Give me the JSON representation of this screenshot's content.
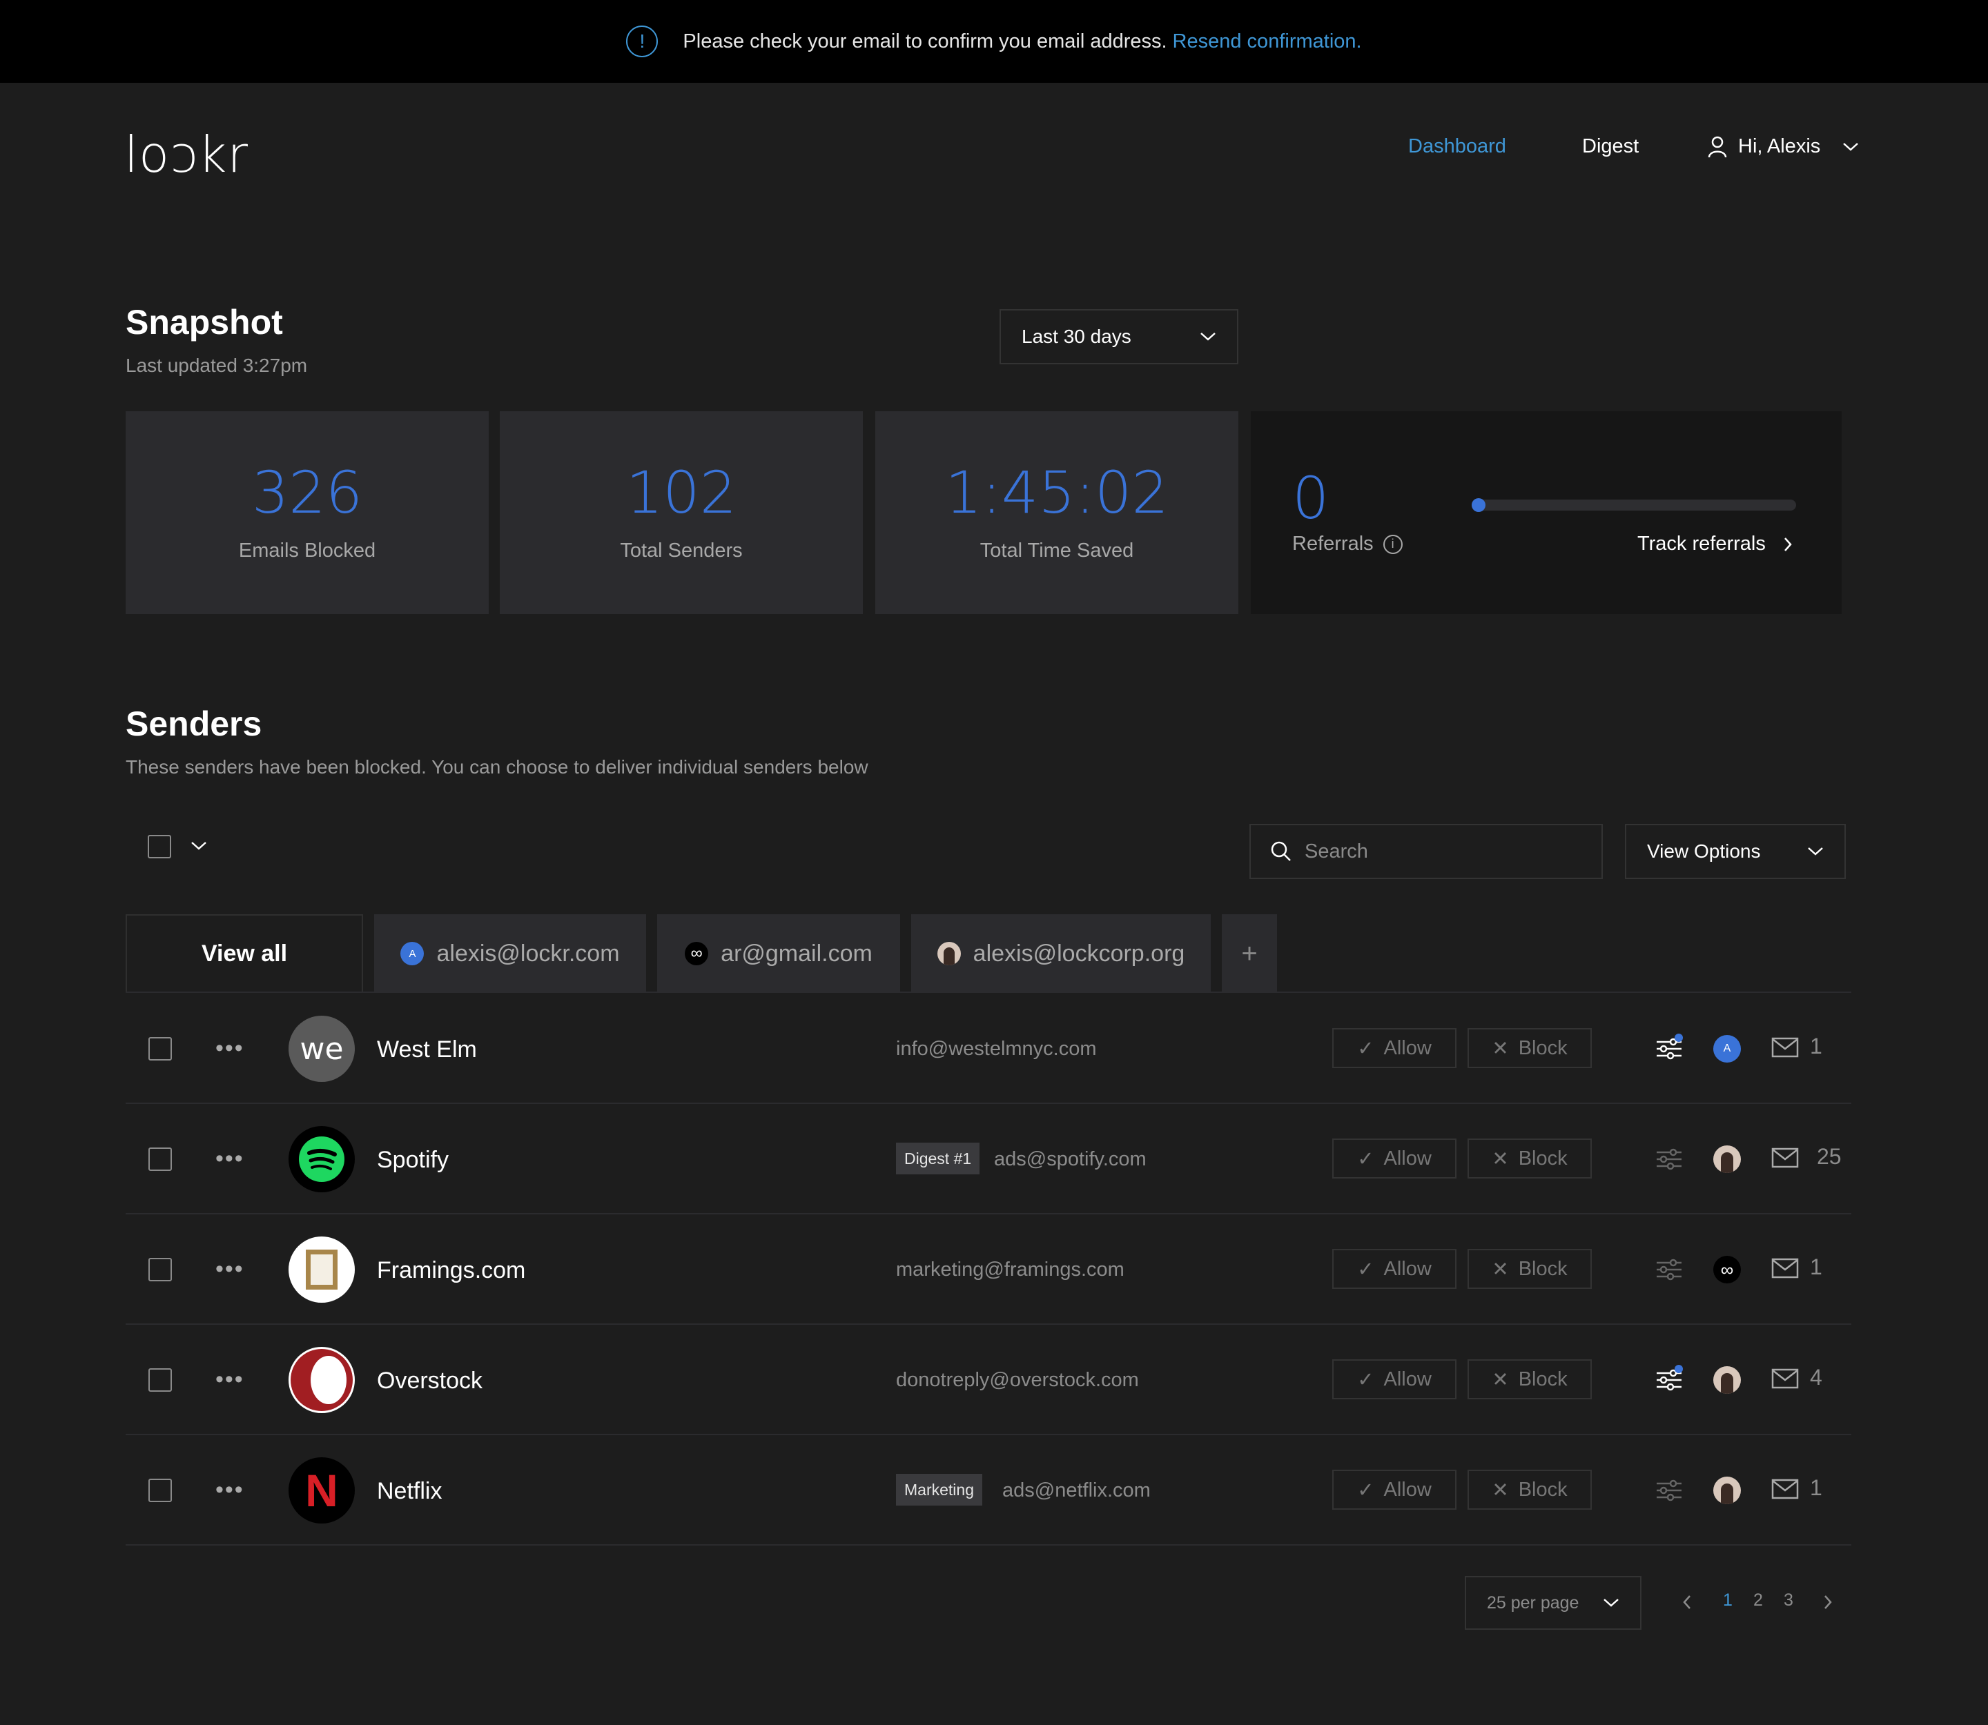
{
  "banner": {
    "icon": "info-icon",
    "message": "Please check your email to confirm you email address.",
    "link": "Resend confirmation."
  },
  "brand": {
    "logo": "lockr",
    "accent": "#3f97d6"
  },
  "nav": {
    "dashboard": "Dashboard",
    "digest": "Digest",
    "user": "Hi, Alexis"
  },
  "snapshot": {
    "title": "Snapshot",
    "updated": "Last updated 3:27pm",
    "range": "Last 30 days",
    "stats": [
      {
        "value": "326",
        "label": "Emails Blocked"
      },
      {
        "value": "102",
        "label": "Total Senders"
      },
      {
        "value": "1:45:02",
        "label": "Total Time Saved"
      }
    ],
    "referrals": {
      "value": "0",
      "label": "Referrals",
      "link": "Track referrals",
      "progress": 0.0
    }
  },
  "senders": {
    "title": "Senders",
    "subtitle": "These senders have been blocked. You can choose to deliver individual senders below",
    "search_placeholder": "Search",
    "view_options": "View Options",
    "tabs": [
      {
        "label": "View all"
      },
      {
        "label": "alexis@lockr.com",
        "icon": "avatar-a-icon"
      },
      {
        "label": "ar@gmail.com",
        "icon": "infinity-icon"
      },
      {
        "label": "alexis@lockcorp.org",
        "icon": "user-photo-icon"
      }
    ],
    "allow": "Allow",
    "block": "Block",
    "rows": [
      {
        "name": "West Elm",
        "email": "info@westelmnyc.com",
        "tag": "",
        "count": "1",
        "logo": "westelm-logo"
      },
      {
        "name": "Spotify",
        "email": "ads@spotify.com",
        "tag": "Digest #1",
        "count": "25",
        "logo": "spotify-logo"
      },
      {
        "name": "Framings.com",
        "email": "marketing@framings.com",
        "tag": "",
        "count": "1",
        "logo": "framings-logo"
      },
      {
        "name": "Overstock",
        "email": "donotreply@overstock.com",
        "tag": "",
        "count": "4",
        "logo": "overstock-logo"
      },
      {
        "name": "Netflix",
        "email": "ads@netflix.com",
        "tag": "Marketing",
        "count": "1",
        "logo": "netflix-logo"
      }
    ]
  },
  "pagination": {
    "per_page": "25 per page",
    "pages": [
      "1",
      "2",
      "3"
    ],
    "current": "1"
  }
}
